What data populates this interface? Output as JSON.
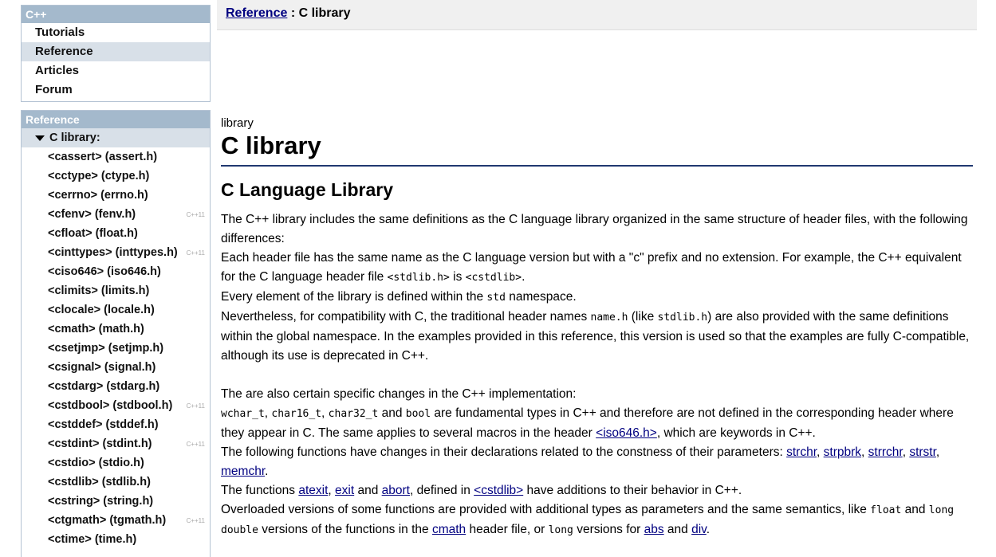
{
  "nav_top": {
    "title": "C++",
    "items": [
      {
        "label": "Tutorials"
      },
      {
        "label": "Reference"
      },
      {
        "label": "Articles"
      },
      {
        "label": "Forum"
      }
    ]
  },
  "nav_ref": {
    "title": "Reference",
    "open_item": "C library:",
    "items": [
      {
        "label": "<cassert> (assert.h)",
        "badge": ""
      },
      {
        "label": "<cctype> (ctype.h)",
        "badge": ""
      },
      {
        "label": "<cerrno> (errno.h)",
        "badge": ""
      },
      {
        "label": "<cfenv> (fenv.h)",
        "badge": "C++11"
      },
      {
        "label": "<cfloat> (float.h)",
        "badge": ""
      },
      {
        "label": "<cinttypes> (inttypes.h)",
        "badge": "C++11"
      },
      {
        "label": "<ciso646> (iso646.h)",
        "badge": ""
      },
      {
        "label": "<climits> (limits.h)",
        "badge": ""
      },
      {
        "label": "<clocale> (locale.h)",
        "badge": ""
      },
      {
        "label": "<cmath> (math.h)",
        "badge": ""
      },
      {
        "label": "<csetjmp> (setjmp.h)",
        "badge": ""
      },
      {
        "label": "<csignal> (signal.h)",
        "badge": ""
      },
      {
        "label": "<cstdarg> (stdarg.h)",
        "badge": ""
      },
      {
        "label": "<cstdbool> (stdbool.h)",
        "badge": "C++11"
      },
      {
        "label": "<cstddef> (stddef.h)",
        "badge": ""
      },
      {
        "label": "<cstdint> (stdint.h)",
        "badge": "C++11"
      },
      {
        "label": "<cstdio> (stdio.h)",
        "badge": ""
      },
      {
        "label": "<cstdlib> (stdlib.h)",
        "badge": ""
      },
      {
        "label": "<cstring> (string.h)",
        "badge": ""
      },
      {
        "label": "<ctgmath> (tgmath.h)",
        "badge": "C++11"
      },
      {
        "label": "<ctime> (time.h)",
        "badge": ""
      }
    ]
  },
  "breadcrumb": {
    "link": "Reference",
    "sep": " : ",
    "current": "C library"
  },
  "main": {
    "kicker": "library",
    "title": "C library",
    "subtitle": "C Language Library",
    "p1": "The C++ library includes the same definitions as the C language library organized in the same structure of header files, with the following differences:",
    "p2a": "Each header file has the same name as the C language version but with a \"",
    "p2c": "c",
    "p2b": "\" prefix and no extension. For example, the C++ equivalent for the C language header file ",
    "p2code1": "<stdlib.h>",
    "p2d": " is ",
    "p2code2": "<cstdlib>",
    "p2e": ".",
    "p3a": "Every element of the library is defined within the ",
    "p3code": "std",
    "p3b": " namespace.",
    "p4a": "Nevertheless, for compatibility with C, the traditional header names ",
    "p4code1": "name.h",
    "p4b": " (like ",
    "p4code2": "stdlib.h",
    "p4c": ") are also provided with the same definitions within the global namespace. In the examples provided in this reference, this version is used so that the examples are fully C-compatible, although its use is deprecated in C++.",
    "p5": "The are also certain specific changes in the C++ implementation:",
    "p6code1": "wchar_t",
    "p6code2": "char16_t",
    "p6code3": "char32_t",
    "p6code4": "bool",
    "comma": ", ",
    "and": " and ",
    "p6a": " are fundamental types in C++ and therefore are not defined in the corresponding header where they appear in C. The same applies to several macros in the header ",
    "p6link": "<iso646.h>",
    "p6b": ", which are keywords in C++.",
    "p7a": "The following functions have changes in their declarations related to the constness of their parameters: ",
    "p7links": [
      "strchr",
      "strpbrk",
      "strrchr",
      "strstr",
      "memchr"
    ],
    "p7end": ".",
    "p8a": "The functions ",
    "p8links": [
      "atexit",
      "exit",
      "abort"
    ],
    "p8b": ", defined in ",
    "p8link": "<cstdlib>",
    "p8c": " have additions to their behavior in C++.",
    "p9a": "Overloaded versions of some functions are provided with additional types as parameters and the same semantics, like ",
    "p9code1": "float",
    "p9b": " and ",
    "p9code2": "long double",
    "p9c": " versions of the functions in the ",
    "p9link1": "cmath",
    "p9d": " header file, or ",
    "p9code3": "long",
    "p9e": " versions for ",
    "p9link2": "abs",
    "p9f": " and ",
    "p9link3": "div",
    "p9g": "."
  }
}
